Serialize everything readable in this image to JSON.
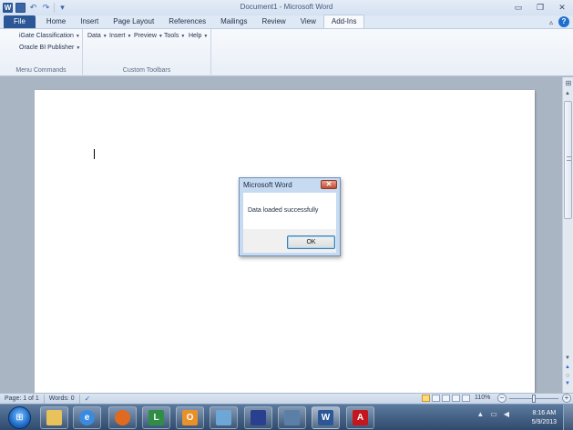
{
  "window": {
    "title": "Document1 - Microsoft Word",
    "controls": {
      "minimize": "▭",
      "maximize": "❐",
      "close": "✕"
    }
  },
  "quick_access": {
    "app_logo": "W",
    "undo": "↶",
    "redo": "↷",
    "customize": "▾"
  },
  "ribbon": {
    "tabs": [
      "File",
      "Home",
      "Insert",
      "Page Layout",
      "References",
      "Mailings",
      "Review",
      "View",
      "Add-Ins"
    ],
    "active_tab": "Add-Ins",
    "collapse": "▵",
    "help": "?",
    "groups": {
      "menu_commands": {
        "label": "Menu Commands",
        "items": [
          "iGate Classification",
          "Oracle BI Publisher"
        ]
      },
      "custom_toolbars": {
        "label": "Custom Toolbars",
        "items": [
          "Data",
          "Insert",
          "Preview",
          "Tools",
          "Help"
        ]
      }
    }
  },
  "status_bar": {
    "page": "Page: 1 of 1",
    "words": "Words: 0",
    "zoom": "110%",
    "zoom_out": "−",
    "zoom_in": "+"
  },
  "dialog": {
    "title": "Microsoft Word",
    "close": "✕",
    "message": "Data loaded successfully",
    "ok_label": "OK"
  },
  "taskbar": {
    "apps": [
      {
        "name": "Windows Explorer",
        "icon": "folder-icon",
        "color": "#e8c25a"
      },
      {
        "name": "Internet Explorer",
        "icon": "ie-icon",
        "color": "#3a8be0"
      },
      {
        "name": "Firefox",
        "icon": "firefox-icon",
        "color": "#e06a1f"
      },
      {
        "name": "Lync",
        "icon": "lync-icon",
        "color": "#2f8d46"
      },
      {
        "name": "Outlook",
        "icon": "outlook-icon",
        "color": "#e8902a"
      },
      {
        "name": "Notes",
        "icon": "notes-icon",
        "color": "#6ea7d6"
      },
      {
        "name": "Calendar",
        "icon": "calendar-icon",
        "color": "#2b3f8f"
      },
      {
        "name": "Media",
        "icon": "media-icon",
        "color": "#5c7fa8"
      },
      {
        "name": "Microsoft Word",
        "icon": "word-icon",
        "color": "#2b5797"
      },
      {
        "name": "Adobe Reader",
        "icon": "pdf-icon",
        "color": "#c4161c"
      }
    ],
    "clock": {
      "time": "8:16 AM",
      "date": "5/9/2013"
    }
  },
  "colors": {
    "file_tab": "#2b5797",
    "dialog_frame": "#c6daf1",
    "close_button": "#c54b33",
    "taskbar": "#2f4a6d"
  }
}
